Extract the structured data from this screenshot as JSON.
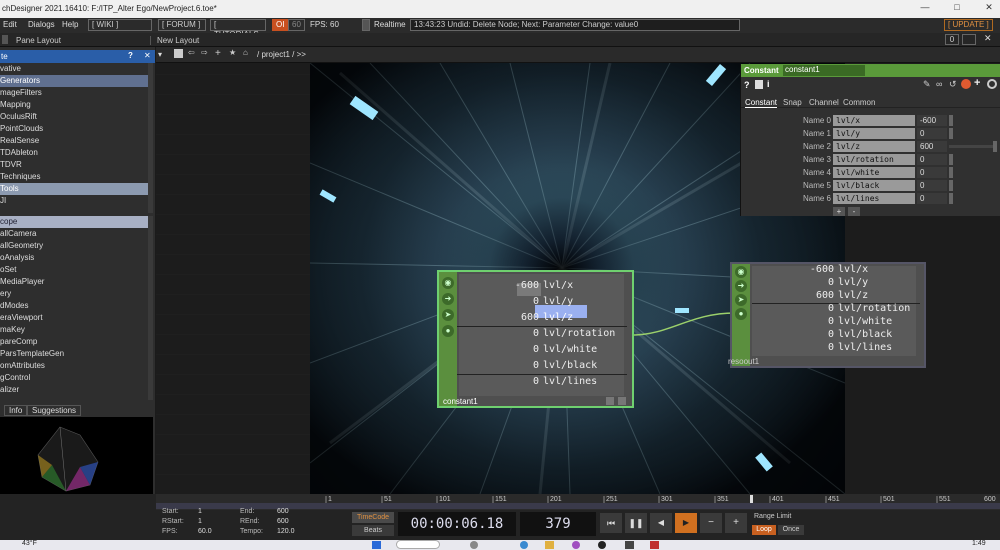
{
  "title_bar": {
    "title": "chDesigner 2021.16410: F:/ITP_Alter Ego/NewProject.6.toe*"
  },
  "menu": {
    "items": [
      "Edit",
      "Dialogs",
      "Help"
    ],
    "buttons": [
      "[ WIKI ]",
      "[ FORUM ]",
      "[ TUTORIALS ]"
    ],
    "oi": "OI",
    "fps_a": "60",
    "fps_label": "FPS:",
    "fps_value": "60",
    "realtime": "Realtime",
    "status": "13:43:23 Undid: Delete Node; Next: Parameter Change: value0",
    "update": "[ UPDATE ]"
  },
  "toolbar2": {
    "pane_layout": "Pane Layout",
    "new_layout": "New Layout"
  },
  "left_panel": {
    "header": "te",
    "items": [
      "vative",
      "Generators",
      "mageFilters",
      "Mapping",
      "OculusRift",
      "PointClouds",
      "RealSense",
      "TDAbleton",
      "TDVR",
      "Techniques",
      "Tools",
      "JI"
    ],
    "items2": [
      "cope",
      "allCamera",
      "allGeometry",
      "oAnalysis",
      "oSet",
      "MediaPlayer",
      "ery",
      "dModes",
      "eraViewport",
      "maKey",
      "pareComp",
      "ParsTemplateGen",
      "omAttributes",
      "gControl",
      "alizer"
    ],
    "tabs": [
      "Info",
      "Suggestions"
    ]
  },
  "network_bar": {
    "path": "/ project1 / >>"
  },
  "node1": {
    "label": "constant1",
    "rows": [
      {
        "v": "-600",
        "n": "lvl/x"
      },
      {
        "v": "0",
        "n": "lvl/y"
      },
      {
        "v": "600",
        "n": "lvl/z"
      },
      {
        "v": "0",
        "n": "lvl/rotation"
      },
      {
        "v": "0",
        "n": "lvl/white"
      },
      {
        "v": "0",
        "n": "lvl/black"
      },
      {
        "v": "0",
        "n": "lvl/lines"
      }
    ]
  },
  "node2": {
    "label": "resoout1",
    "rows": [
      {
        "v": "-600",
        "n": "lvl/x"
      },
      {
        "v": "0",
        "n": "lvl/y"
      },
      {
        "v": "600",
        "n": "lvl/z"
      },
      {
        "v": "0",
        "n": "lvl/rotation"
      },
      {
        "v": "0",
        "n": "lvl/white"
      },
      {
        "v": "0",
        "n": "lvl/black"
      },
      {
        "v": "0",
        "n": "lvl/lines"
      }
    ]
  },
  "params": {
    "type": "Constant",
    "name": "constant1",
    "tabs": [
      "Constant",
      "Snap",
      "Channel",
      "Common"
    ],
    "rows": [
      {
        "label": "Name 0",
        "name": "lvl/x",
        "value": "-600"
      },
      {
        "label": "Name 1",
        "name": "lvl/y",
        "value": "0"
      },
      {
        "label": "Name 2",
        "name": "lvl/z",
        "value": "600"
      },
      {
        "label": "Name 3",
        "name": "lvl/rotation",
        "value": "0"
      },
      {
        "label": "Name 4",
        "name": "lvl/white",
        "value": "0"
      },
      {
        "label": "Name 5",
        "name": "lvl/black",
        "value": "0"
      },
      {
        "label": "Name 6",
        "name": "lvl/lines",
        "value": "0"
      }
    ]
  },
  "timeline": {
    "ticks": [
      "1",
      "51",
      "101",
      "151",
      "201",
      "251",
      "301",
      "351",
      "401",
      "451",
      "501",
      "551",
      "600"
    ]
  },
  "bottom": {
    "start_label": "Start:",
    "start": "1",
    "rstart_label": "RStart:",
    "rstart": "1",
    "fps_label": "FPS:",
    "fps": "60.0",
    "end_label": "End:",
    "end": "600",
    "rend_label": "REnd:",
    "rend": "600",
    "tempo_label": "Tempo:",
    "tempo": "120.0",
    "timecode": "TimeCode",
    "beats": "Beats",
    "time": "00:00:06.18",
    "frame": "379",
    "range_limit": "Range Limit",
    "loop": "Loop",
    "once": "Once"
  },
  "taskbar": {
    "weather": "43°F",
    "clock": "1:49"
  }
}
